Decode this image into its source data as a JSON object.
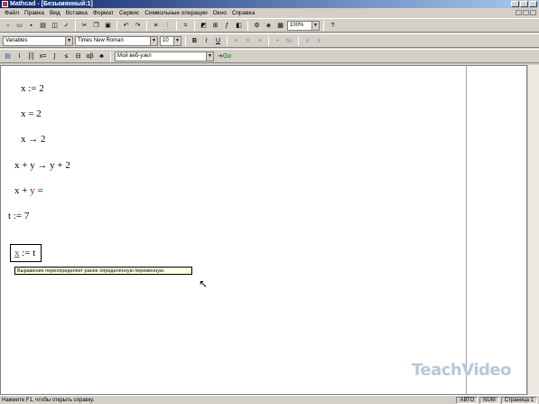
{
  "window": {
    "title": "Mathcad - [Безымянный:1]"
  },
  "menu": [
    "Файл",
    "Правка",
    "Вид",
    "Вставка",
    "Формат",
    "Сервис",
    "Символьные операции",
    "Окно",
    "Справка"
  ],
  "toolbar": {
    "zoom": "100%"
  },
  "format_bar": {
    "style": "Variables",
    "font": "Times New Roman",
    "size": "10"
  },
  "math_bar": {
    "web_label": "Мой веб-узел",
    "go_label": "Go"
  },
  "document": {
    "expressions": [
      {
        "parts": [
          "x := 2"
        ]
      },
      {
        "parts": [
          "x = 2"
        ]
      },
      {
        "parts": [
          "x → 2"
        ]
      },
      {
        "parts": [
          "x + y → y + 2"
        ]
      },
      {
        "parts": [
          "x + ",
          "y",
          " ="
        ]
      },
      {
        "parts": [
          "t := 7"
        ]
      }
    ],
    "selected": {
      "var": "x",
      "rest": " := t"
    },
    "tooltip": "Выражение переопределяет ранее определенную переменную."
  },
  "watermark": "TeachVideo",
  "status": {
    "text": "Нажмите F1, чтобы открыть справку.",
    "mode": "АВТО",
    "num": "NUM",
    "page": "Страница 1"
  }
}
